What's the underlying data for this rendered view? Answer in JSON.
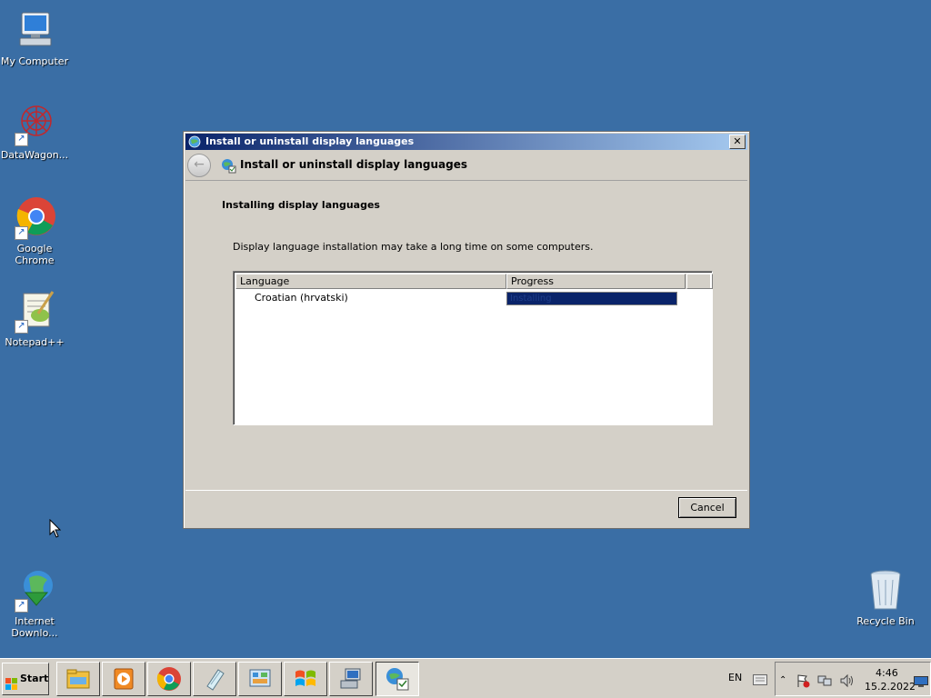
{
  "desktop": {
    "icons": [
      {
        "label": "My Computer"
      },
      {
        "label": "DataWagon..."
      },
      {
        "label": "Google Chrome"
      },
      {
        "label": "Notepad++"
      },
      {
        "label_line1": "Internet",
        "label_line2": "Downlo..."
      },
      {
        "label": "Recycle Bin"
      }
    ]
  },
  "dialog": {
    "title": "Install or uninstall display languages",
    "nav_title": "Install or uninstall display languages",
    "heading": "Installing display languages",
    "description": "Display language installation may take a long time on some computers.",
    "columns": [
      "Language",
      "Progress"
    ],
    "rows": [
      {
        "language": "Croatian (hrvatski)",
        "status": "Installing",
        "progress": 1.0
      }
    ],
    "cancel_label": "Cancel",
    "close_label": "✕"
  },
  "taskbar": {
    "start_label": "Start",
    "apps": [
      "file-explorer-icon",
      "media-player-icon",
      "chrome-icon",
      "notepad-icon",
      "control-panel-icon",
      "windows-icon",
      "network-computer-icon",
      "language-globe-icon"
    ],
    "language": "EN",
    "time": "4:46",
    "date": "15.2.2022"
  },
  "colors": {
    "desktop": "#3a6ea5",
    "title_bar_start": "#0a246a",
    "title_bar_end": "#a6caf0",
    "progress_fill": "#0a246a",
    "window_face": "#d4d0c8"
  }
}
